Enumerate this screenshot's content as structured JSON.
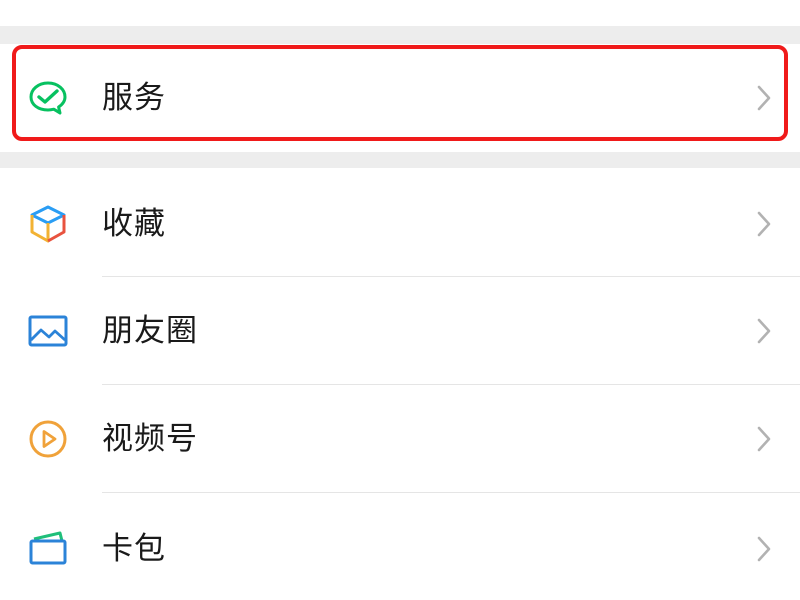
{
  "menu": {
    "service": {
      "label": "服务",
      "icon": "wechat-pay-check-icon",
      "color": "#07c160"
    },
    "items": [
      {
        "label": "收藏",
        "icon": "favorites-cube-icon",
        "colors": [
          "#2a9df4",
          "#f2b233",
          "#e8533f"
        ]
      },
      {
        "label": "朋友圈",
        "icon": "moments-picture-icon",
        "color": "#2b83d8"
      },
      {
        "label": "视频号",
        "icon": "channels-play-icon",
        "color": "#f0a23a"
      },
      {
        "label": "卡包",
        "icon": "card-wallet-icon",
        "colors": [
          "#2b83d8",
          "#1fbf7a"
        ]
      }
    ]
  },
  "chevron_icon": "chevron-right-icon",
  "highlight_color": "#f01a1a"
}
